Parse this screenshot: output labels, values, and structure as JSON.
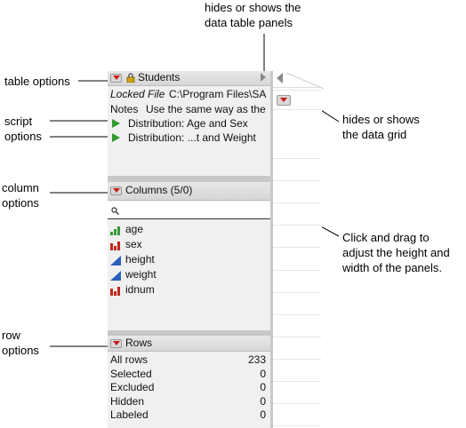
{
  "callouts": {
    "data_panels": [
      "hides or shows the",
      "data table panels"
    ],
    "table_options": "table options",
    "script_options": [
      "script",
      "options"
    ],
    "data_grid": [
      "hides or shows",
      "the data grid"
    ],
    "column_options": [
      "column",
      "options"
    ],
    "drag": [
      "Click and drag to",
      "adjust the height and",
      "width of the panels."
    ],
    "row_options": [
      "row",
      "options"
    ]
  },
  "table_panel": {
    "title": "Students",
    "locked_label": "Locked File",
    "locked_path": "C:\\Program Files\\SA",
    "notes_label": "Notes",
    "notes_text": "Use the same way as the",
    "scripts": [
      "Distribution: Age and Sex",
      "Distribution: ...t and Weight"
    ]
  },
  "columns_panel": {
    "title": "Columns (5/0)",
    "search_placeholder": "",
    "columns": [
      {
        "name": "age",
        "icon": "ordinal-icon"
      },
      {
        "name": "sex",
        "icon": "nominal-icon"
      },
      {
        "name": "height",
        "icon": "continuous-icon"
      },
      {
        "name": "weight",
        "icon": "continuous-icon"
      },
      {
        "name": "idnum",
        "icon": "nominal-icon"
      }
    ]
  },
  "rows_panel": {
    "title": "Rows",
    "rows": [
      {
        "label": "All rows",
        "value": "233"
      },
      {
        "label": "Selected",
        "value": "0"
      },
      {
        "label": "Excluded",
        "value": "0"
      },
      {
        "label": "Hidden",
        "value": "0"
      },
      {
        "label": "Labeled",
        "value": "0"
      }
    ]
  },
  "colors": {
    "red_triangle": "#d01818",
    "green_script": "#2f9a2f",
    "nominal_red": "#c0281c",
    "continuous_blue": "#2b5fbd",
    "ordinal_green": "#3a9a3a"
  }
}
